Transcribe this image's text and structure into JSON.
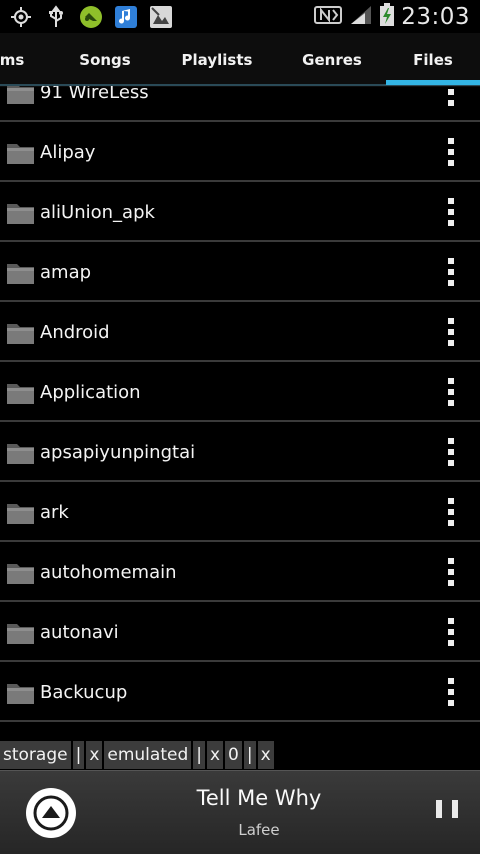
{
  "status_bar": {
    "icons_left": [
      "gps-icon",
      "usb-icon",
      "game-icon",
      "music-app-icon",
      "image-icon"
    ],
    "icons_right": [
      "nfc-icon",
      "signal-icon",
      "battery-charging-icon"
    ],
    "time": "23:03"
  },
  "tabs": [
    {
      "label": "ms"
    },
    {
      "label": "Songs"
    },
    {
      "label": "Playlists"
    },
    {
      "label": "Genres"
    },
    {
      "label": "Files",
      "selected": true
    }
  ],
  "folders": [
    {
      "name": "91 WireLess"
    },
    {
      "name": "Alipay"
    },
    {
      "name": "aliUnion_apk"
    },
    {
      "name": "amap"
    },
    {
      "name": "Android"
    },
    {
      "name": "Application"
    },
    {
      "name": "apsapiyunpingtai"
    },
    {
      "name": "ark"
    },
    {
      "name": "autohomemain"
    },
    {
      "name": "autonavi"
    },
    {
      "name": "Backucup"
    }
  ],
  "breadcrumb": [
    {
      "label": "storage",
      "sep": "|",
      "close": "x"
    },
    {
      "label": "emulated",
      "sep": "|",
      "close": "x"
    },
    {
      "label": "0",
      "sep": "|",
      "close": "x"
    }
  ],
  "now_playing": {
    "title": "Tell Me Why",
    "artist": "Lafee"
  },
  "colors": {
    "accent": "#33b5e5",
    "background": "#000000",
    "divider": "#3a3a3a"
  }
}
